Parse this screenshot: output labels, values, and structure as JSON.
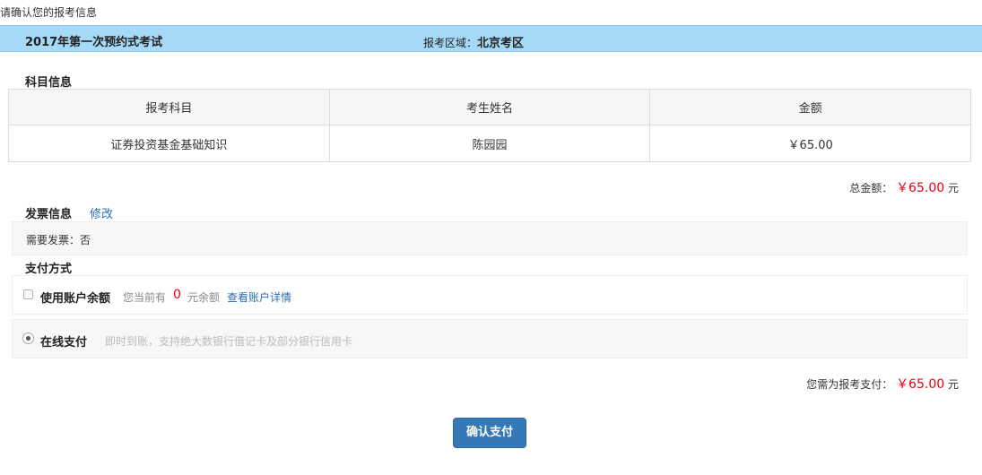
{
  "page": {
    "heading": "请确认您的报考信息"
  },
  "exam": {
    "name": "2017年第一次预约式考试",
    "region_label": "报考区域：",
    "region_value": "北京考区"
  },
  "subject_section": {
    "title": "科目信息",
    "columns": [
      "报考科目",
      "考生姓名",
      "金额"
    ],
    "rows": [
      {
        "subject": "证券投资基金基础知识",
        "name": "陈园园",
        "amount": "￥65.00"
      }
    ],
    "total_label": "总金额：",
    "total_value": "￥65.00",
    "total_unit": "元"
  },
  "invoice": {
    "title": "发票信息",
    "edit_label": "修改",
    "need_invoice": "需要发票：否"
  },
  "payment": {
    "title": "支付方式",
    "balance_option": {
      "label": "使用账户余额",
      "hint_prefix": "您当前有",
      "balance": "0",
      "hint_suffix": "元余额",
      "detail_link": "查看账户详情",
      "checked": false
    },
    "online_option": {
      "label": "在线支付",
      "description": "即时到账，支持绝大数银行借记卡及部分银行信用卡",
      "selected": true
    },
    "due_label": "您需为报考支付：",
    "due_value": "￥65.00",
    "due_unit": "元"
  },
  "actions": {
    "confirm_label": "确认支付"
  },
  "colors": {
    "header_bar": "#a6d8f7",
    "price_red": "#e60012",
    "link_blue": "#2a6db5",
    "button_blue": "#3478b8"
  }
}
